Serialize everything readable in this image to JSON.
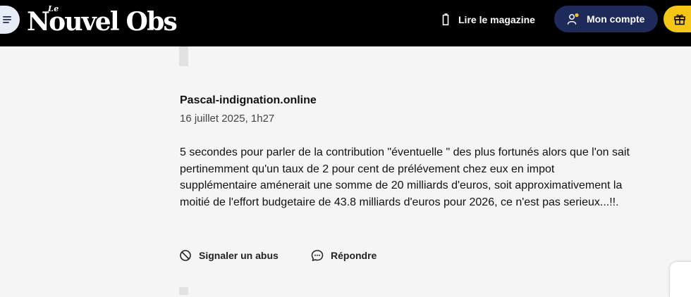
{
  "header": {
    "logo_small": "Le",
    "logo_main": "Nouvel Obs",
    "menu_icon": "menu-icon",
    "lire_icon": "phone-icon",
    "lire_label": "Lire le magazine",
    "compte_icon": "user-icon",
    "compte_label": "Mon compte",
    "gift_icon": "gift-icon",
    "colors": {
      "topbar": "#000000",
      "compte_bg": "#1e2a5a",
      "notification_dot": "#f5c518",
      "gift_bg": "#f5c518"
    }
  },
  "comment": {
    "author": "Pascal-indignation.online",
    "date": "16 juillet 2025, 1h27",
    "text": "5 secondes pour parler de la contribution \"éventuelle \" des plus fortunés alors que l'on sait pertinemment qu'un taux de 2 pour cent de prélévement chez eux en impot supplémentaire aménerait une somme de 20 milliards d'euros, soit approximativement la moitié de l'effort budgetaire de 43.8 milliards d'euros pour 2026, ce n'est pas serieux...!!.",
    "actions": {
      "report_icon": "block-icon",
      "report_label": "Signaler un abus",
      "reply_icon": "chat-bubble-icon",
      "reply_label": "Répondre"
    }
  }
}
